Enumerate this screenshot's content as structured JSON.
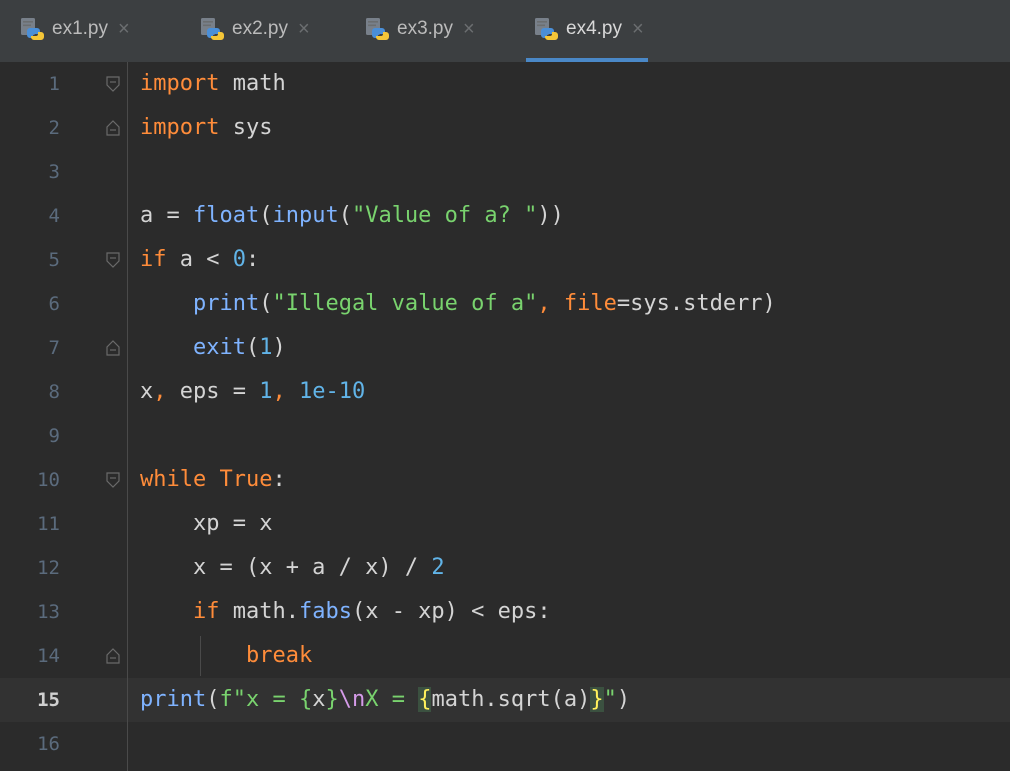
{
  "tabs": [
    {
      "label": "ex1.py",
      "close": "×",
      "active": false
    },
    {
      "label": "ex2.py",
      "close": "×",
      "active": false
    },
    {
      "label": "ex3.py",
      "close": "×",
      "active": false
    },
    {
      "label": "ex4.py",
      "close": "×",
      "active": true
    }
  ],
  "editor": {
    "current_line": 15,
    "lines": [
      {
        "n": "1",
        "text": "import math"
      },
      {
        "n": "2",
        "text": "import sys"
      },
      {
        "n": "3",
        "text": ""
      },
      {
        "n": "4",
        "text": "a = float(input(\"Value of a? \"))"
      },
      {
        "n": "5",
        "text": "if a < 0:"
      },
      {
        "n": "6",
        "text": "    print(\"Illegal value of a\", file=sys.stderr)"
      },
      {
        "n": "7",
        "text": "    exit(1)"
      },
      {
        "n": "8",
        "text": "x, eps = 1, 1e-10"
      },
      {
        "n": "9",
        "text": ""
      },
      {
        "n": "10",
        "text": "while True:"
      },
      {
        "n": "11",
        "text": "    xp = x"
      },
      {
        "n": "12",
        "text": "    x = (x + a / x) / 2"
      },
      {
        "n": "13",
        "text": "    if math.fabs(x - xp) < eps:"
      },
      {
        "n": "14",
        "text": "        break"
      },
      {
        "n": "15",
        "text": "print(f\"x = {x}\\nX = {math.sqrt(a)}\")"
      },
      {
        "n": "16",
        "text": ""
      }
    ]
  },
  "colors": {
    "background": "#2b2b2b",
    "keyword": "#ff8c3a",
    "function": "#7fb3ff",
    "string": "#79d36e",
    "number": "#61b4e8",
    "tab_underline": "#4a88c7"
  },
  "icons": {
    "tab_file_icon": "python-file-icon",
    "fold_marker": "fold-marker-icon"
  }
}
